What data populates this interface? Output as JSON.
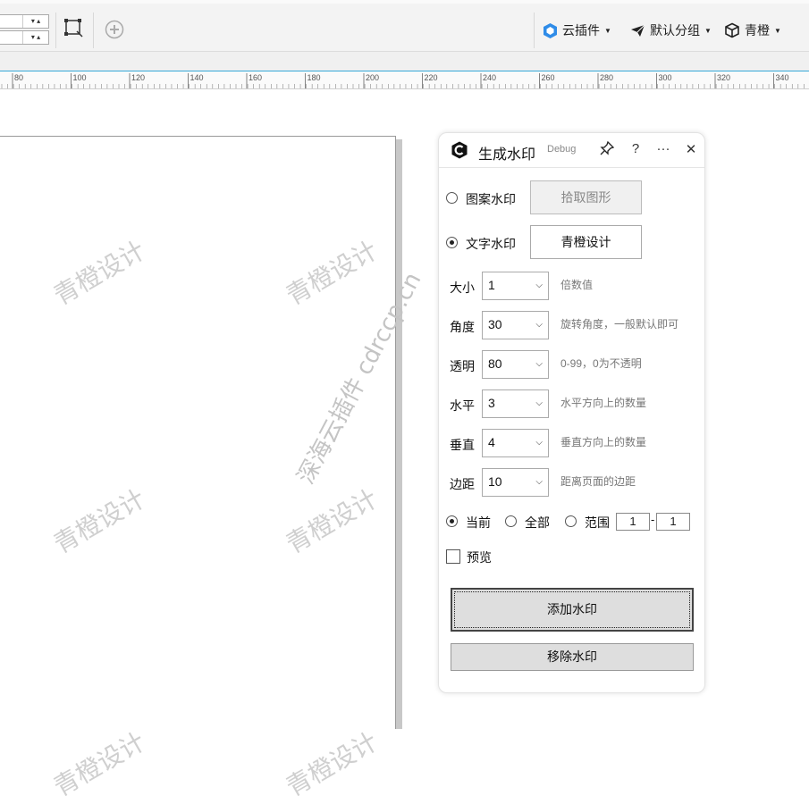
{
  "toolbar": {
    "spin_top_value": "",
    "spin_bottom_value": "",
    "cloud_plugin_label": "云插件",
    "default_group_label": "默认分组",
    "user_label": "青橙"
  },
  "ruler": {
    "ticks": [
      "80",
      "100",
      "120",
      "140",
      "160",
      "180",
      "200",
      "220",
      "240",
      "260",
      "280",
      "300",
      "320",
      "340"
    ]
  },
  "canvas": {
    "watermark_text": "青橙设计",
    "site_watermark_text": "深海云插件 cdrccp.cn"
  },
  "panel": {
    "title": "生成水印",
    "debug_label": "Debug",
    "pin_icon": "pin-icon",
    "help_label": "?",
    "more_label": "···",
    "close_label": "✕",
    "pattern_watermark_label": "图案水印",
    "pick_shape_button": "拾取图形",
    "text_watermark_label": "文字水印",
    "text_watermark_value": "青橙设计",
    "fields": [
      {
        "label": "大小",
        "value": "1",
        "hint": "倍数值"
      },
      {
        "label": "角度",
        "value": "30",
        "hint": "旋转角度，一般默认即可"
      },
      {
        "label": "透明",
        "value": "80",
        "hint": "0-99，0为不透明"
      },
      {
        "label": "水平",
        "value": "3",
        "hint": "水平方向上的数量"
      },
      {
        "label": "垂直",
        "value": "4",
        "hint": "垂直方向上的数量"
      },
      {
        "label": "边距",
        "value": "10",
        "hint": "距离页面的边距"
      }
    ],
    "scope_current_label": "当前",
    "scope_all_label": "全部",
    "scope_range_label": "范围",
    "range_from": "1",
    "range_separator": "-",
    "range_to": "1",
    "preview_label": "预览",
    "add_watermark_button": "添加水印",
    "remove_watermark_button": "移除水印"
  }
}
